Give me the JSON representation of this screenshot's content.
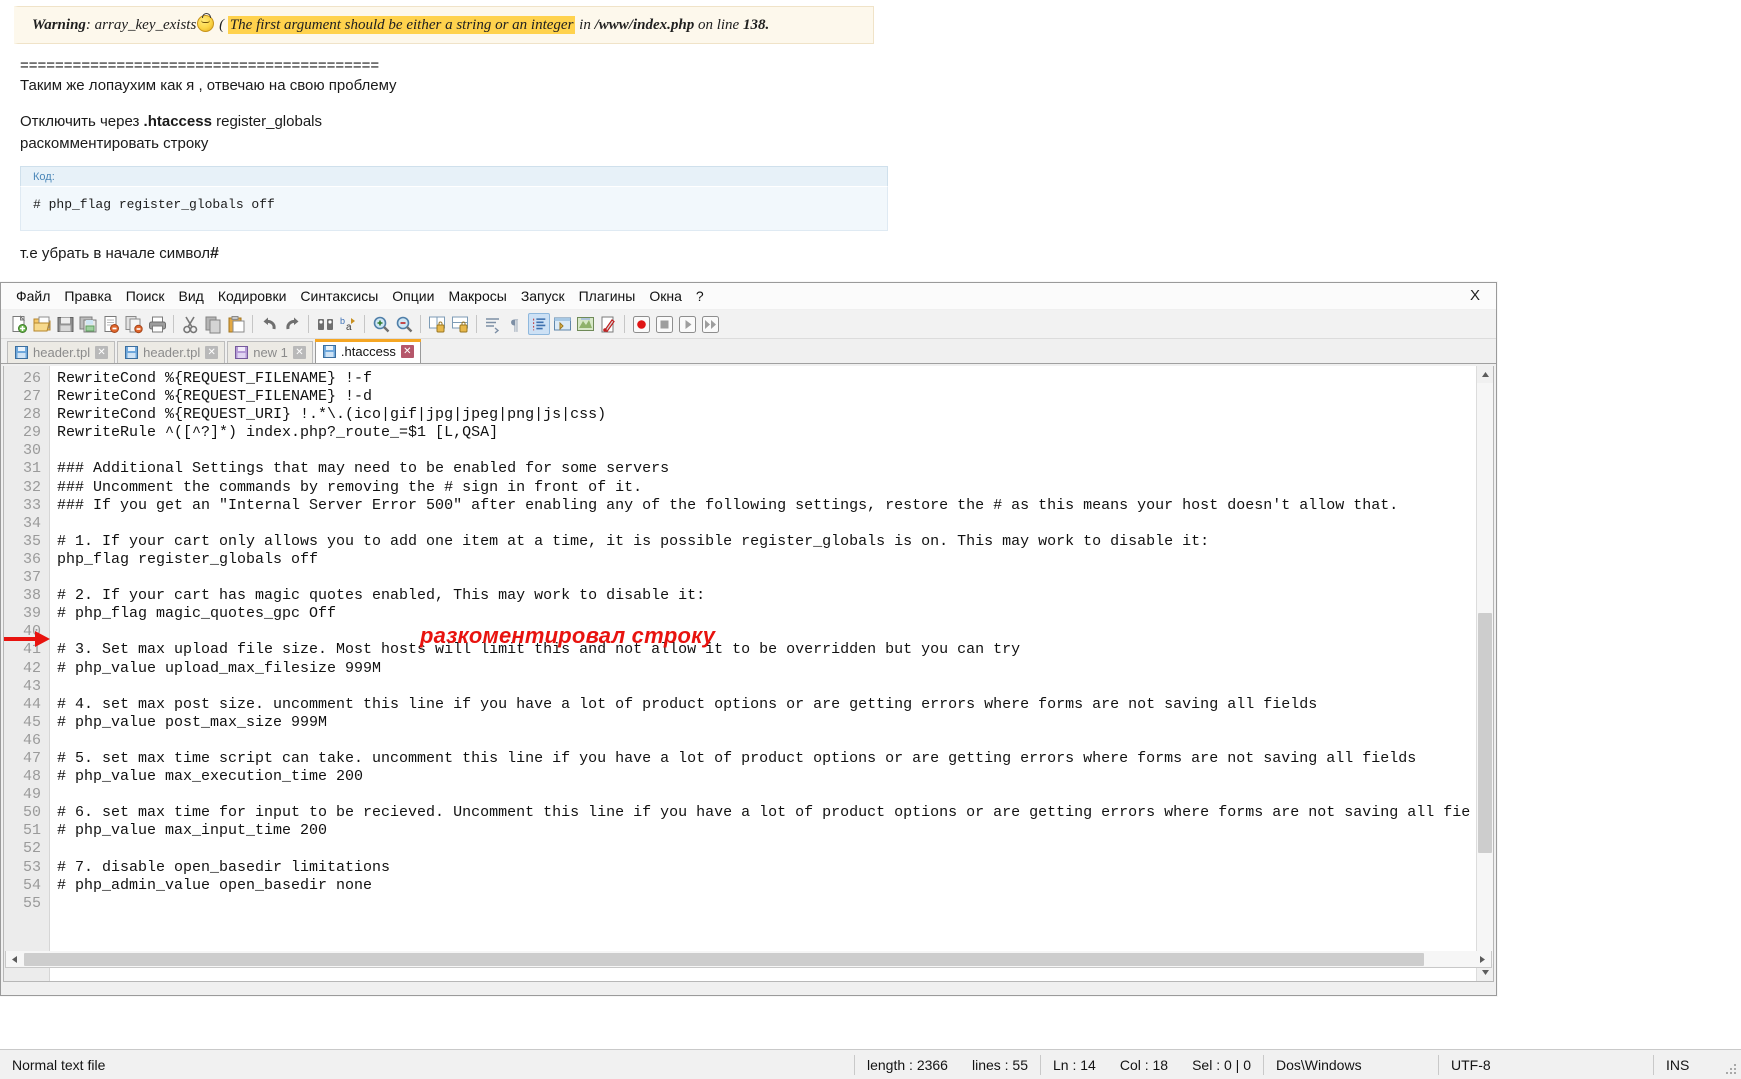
{
  "forum": {
    "warning": {
      "label": "Warning",
      "func": ": array_key_exists",
      "open_paren": " ( ",
      "highlight": "The first argument should be either a string or an integer",
      "in_word": " in ",
      "file": "/www/index.php",
      "online": " on line ",
      "line_no": "138.",
      "highlight_color": "#ffd24d",
      "box_bg": "#fdf8ec"
    },
    "separator": "=========================================",
    "line1": "Таким же лопаухим как я , отвечаю на свою проблему",
    "line2_prefix": "Отключить через ",
    "line2_bold": ".htaccess",
    "line2_suffix": " register_globals",
    "line3": "раскомментировать строку",
    "code_label": "Код:",
    "code_content": "# php_flag register_globals off",
    "tail_prefix": "т.е убрать в начале символ",
    "tail_bold": "#"
  },
  "npp": {
    "window_close": "X",
    "menu": [
      "Файл",
      "Правка",
      "Поиск",
      "Вид",
      "Кодировки",
      "Синтаксисы",
      "Опции",
      "Макросы",
      "Запуск",
      "Плагины",
      "Окна",
      "?"
    ],
    "toolbar_icons": [
      "new-file-icon",
      "open-file-icon",
      "save-icon",
      "save-all-icon",
      "close-file-icon",
      "close-all-icon",
      "print-icon",
      "sep",
      "cut-icon",
      "copy-icon",
      "paste-icon",
      "sep",
      "undo-icon",
      "redo-icon",
      "sep",
      "find-icon",
      "replace-icon",
      "sep",
      "zoom-in-icon",
      "zoom-out-icon",
      "sep",
      "sync-vertical-scroll-icon",
      "sync-horizontal-scroll-icon",
      "sep",
      "word-wrap-icon",
      "show-all-characters-icon",
      "indent-guideline-icon",
      "user-defined-dialog-icon",
      "document-map-icon",
      "function-list-icon",
      "sep",
      "record-macro-icon",
      "stop-recording-icon",
      "playback-macro-icon",
      "run-macro-multiple-icon"
    ],
    "tabs": [
      {
        "label": "header.tpl",
        "active": false,
        "icon": "saved-file-icon",
        "close": "✕"
      },
      {
        "label": "header.tpl",
        "active": false,
        "icon": "saved-file-icon",
        "close": "✕"
      },
      {
        "label": "new 1",
        "active": false,
        "icon": "unsaved-file-icon",
        "close": "✕"
      },
      {
        "label": ".htaccess",
        "active": true,
        "icon": "saved-file-icon",
        "close": "✕"
      }
    ],
    "active_tab_accent": "#f5a623",
    "editor": {
      "first_line_number": 26,
      "lines": [
        {
          "n": 26,
          "text": "RewriteCond %{REQUEST_FILENAME} !-f"
        },
        {
          "n": 27,
          "text": "RewriteCond %{REQUEST_FILENAME} !-d"
        },
        {
          "n": 28,
          "text": "RewriteCond %{REQUEST_URI} !.*\\.(ico|gif|jpg|jpeg|png|js|css)"
        },
        {
          "n": 29,
          "text": "RewriteRule ^([^?]*) index.php?_route_=$1 [L,QSA]"
        },
        {
          "n": 30,
          "text": ""
        },
        {
          "n": 31,
          "text": "### Additional Settings that may need to be enabled for some servers"
        },
        {
          "n": 32,
          "text": "### Uncomment the commands by removing the # sign in front of it."
        },
        {
          "n": 33,
          "text": "### If you get an \"Internal Server Error 500\" after enabling any of the following settings, restore the # as this means your host doesn't allow that."
        },
        {
          "n": 34,
          "text": ""
        },
        {
          "n": 35,
          "text": "# 1. If your cart only allows you to add one item at a time, it is possible register_globals is on. This may work to disable it:"
        },
        {
          "n": 36,
          "text": "php_flag register_globals off"
        },
        {
          "n": 37,
          "text": ""
        },
        {
          "n": 38,
          "text": "# 2. If your cart has magic quotes enabled, This may work to disable it:"
        },
        {
          "n": 39,
          "text": "# php_flag magic_quotes_gpc Off"
        },
        {
          "n": 40,
          "text": ""
        },
        {
          "n": 41,
          "text": "# 3. Set max upload file size. Most hosts will limit this and not allow it to be overridden but you can try"
        },
        {
          "n": 42,
          "text": "# php_value upload_max_filesize 999M"
        },
        {
          "n": 43,
          "text": ""
        },
        {
          "n": 44,
          "text": "# 4. set max post size. uncomment this line if you have a lot of product options or are getting errors where forms are not saving all fields"
        },
        {
          "n": 45,
          "text": "# php_value post_max_size 999M"
        },
        {
          "n": 46,
          "text": ""
        },
        {
          "n": 47,
          "text": "# 5. set max time script can take. uncomment this line if you have a lot of product options or are getting errors where forms are not saving all fields"
        },
        {
          "n": 48,
          "text": "# php_value max_execution_time 200"
        },
        {
          "n": 49,
          "text": ""
        },
        {
          "n": 50,
          "text": "# 6. set max time for input to be recieved. Uncomment this line if you have a lot of product options or are getting errors where forms are not saving all fie"
        },
        {
          "n": 51,
          "text": "# php_value max_input_time 200"
        },
        {
          "n": 52,
          "text": ""
        },
        {
          "n": 53,
          "text": "# 7. disable open_basedir limitations"
        },
        {
          "n": 54,
          "text": "# php_admin_value open_basedir none"
        },
        {
          "n": 55,
          "text": ""
        }
      ]
    },
    "annotation": {
      "text": "разкоментировал строку",
      "color": "#e8130f",
      "arrow_target_line": 36
    }
  },
  "status": {
    "file_type": "Normal text file",
    "length_label": "length : 2366",
    "lines_label": "lines : 55",
    "ln": "Ln : 14",
    "col": "Col : 18",
    "sel": "Sel : 0 | 0",
    "eol": "Dos\\Windows",
    "encoding": "UTF-8",
    "insert_mode": "INS"
  }
}
